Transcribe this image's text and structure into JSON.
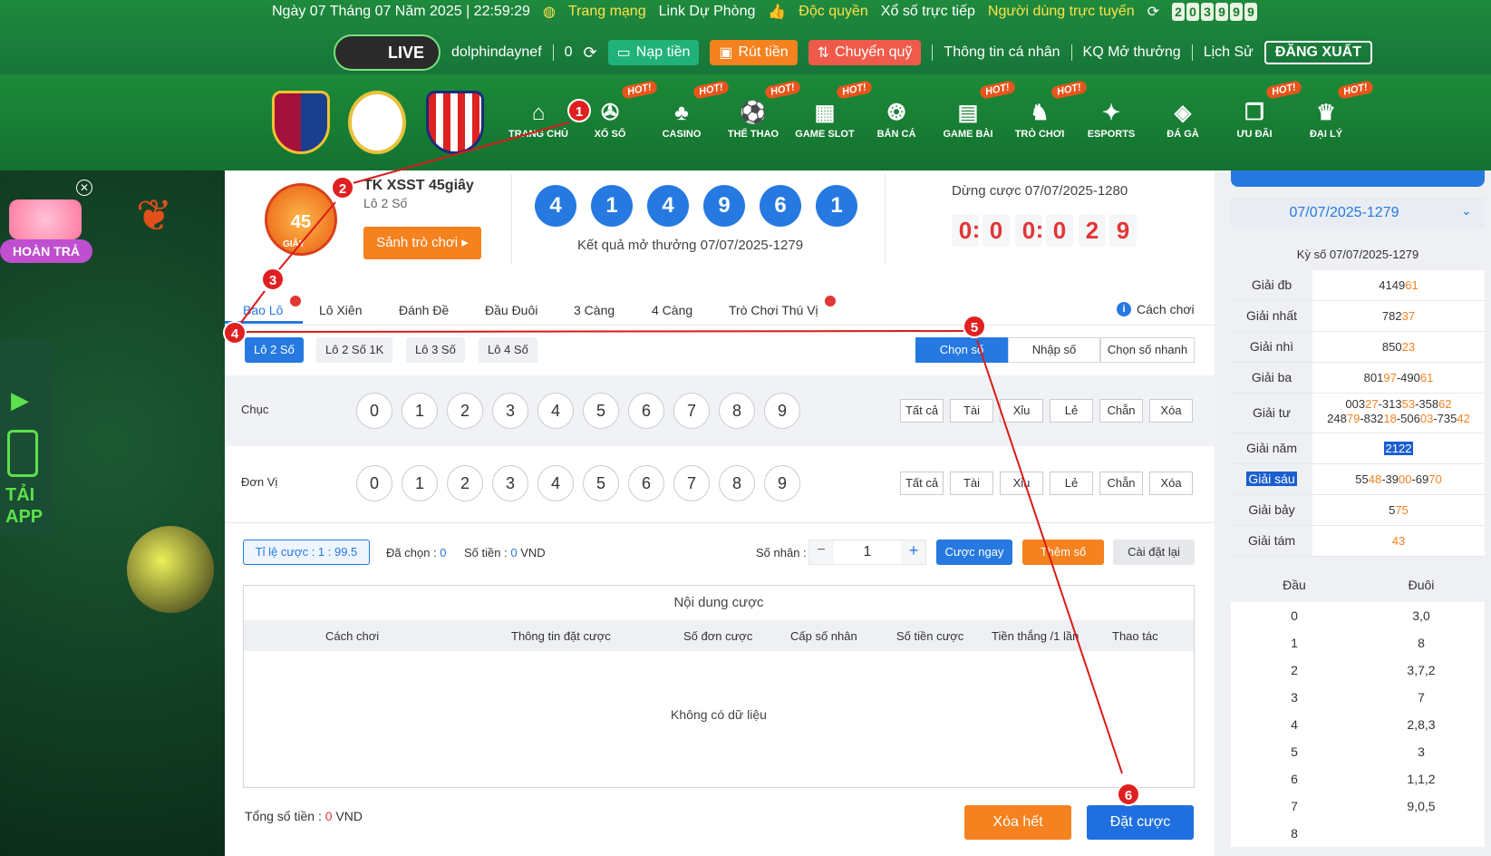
{
  "top": {
    "date": "Ngày 07 Tháng 07 Năm 2025 | 22:59:29",
    "site": "Trang mạng",
    "backup": "Link Dự Phòng",
    "exclusive": "Độc quyền",
    "lottery_live": "Xổ số trực tiếp",
    "online_users_label": "Người dùng trực tuyến",
    "online_users_digits": [
      "2",
      "0",
      "3",
      "9",
      "9",
      "9"
    ]
  },
  "userbar": {
    "live": "LIVE",
    "username": "dolphindaynef",
    "balance": "0",
    "deposit": "Nạp tiền",
    "withdraw": "Rút tiền",
    "transfer": "Chuyển quỹ",
    "profile": "Thông tin cá nhân",
    "results": "KQ Mở thưởng",
    "history": "Lịch Sử",
    "logout": "ĐĂNG XUẤT"
  },
  "nav": [
    {
      "label": "TRANG CHỦ",
      "hot": false
    },
    {
      "label": "XỔ SỐ",
      "hot": true
    },
    {
      "label": "CASINO",
      "hot": true
    },
    {
      "label": "THỂ THAO",
      "hot": true
    },
    {
      "label": "GAME SLOT",
      "hot": true
    },
    {
      "label": "BẮN CÁ",
      "hot": false
    },
    {
      "label": "GAME BÀI",
      "hot": true
    },
    {
      "label": "TRÒ CHƠI",
      "hot": true
    },
    {
      "label": "ESPORTS",
      "hot": false
    },
    {
      "label": "ĐÁ GÀ",
      "hot": false
    },
    {
      "label": "ƯU ĐÃI",
      "hot": true
    },
    {
      "label": "ĐẠI LÝ",
      "hot": true
    }
  ],
  "hot_label": "HOT!",
  "left": {
    "refund": "HOÀN TRẢ",
    "app1": "TẢI",
    "app2": "APP"
  },
  "game": {
    "logo": "45",
    "logo_sub": "GIÂY",
    "title": "TK XSST 45giây",
    "subtitle": "Lô 2 Số",
    "lobby": "Sảnh trò chơi ▸",
    "result_balls": [
      "4",
      "1",
      "4",
      "9",
      "6",
      "1"
    ],
    "result_caption": "Kết quả mở thưởng 07/07/2025-1279",
    "stop_caption": "Dừng cược 07/07/2025-1280",
    "timer": [
      "0",
      "0",
      "0",
      "0",
      "2",
      "9"
    ]
  },
  "tabs": [
    "Bao Lô",
    "Lô Xiên",
    "Đánh Đề",
    "Đầu Đuôi",
    "3 Càng",
    "4 Càng",
    "Trò Chơi Thú Vị"
  ],
  "how_to": "Cách chơi",
  "subtabs": [
    "Lô 2 Số",
    "Lô 2 Số 1K",
    "Lô 3 Số",
    "Lô 4 Số"
  ],
  "modes": [
    "Chọn số",
    "Nhập số",
    "Chọn số nhanh"
  ],
  "rows": [
    {
      "label": "Chục",
      "numbers": [
        "0",
        "1",
        "2",
        "3",
        "4",
        "5",
        "6",
        "7",
        "8",
        "9"
      ]
    },
    {
      "label": "Đơn Vị",
      "numbers": [
        "0",
        "1",
        "2",
        "3",
        "4",
        "5",
        "6",
        "7",
        "8",
        "9"
      ]
    }
  ],
  "filters": [
    "Tất cả",
    "Tài",
    "Xỉu",
    "Lẻ",
    "Chẵn",
    "Xóa"
  ],
  "bet": {
    "ratio": "Tỉ lệ cược : 1 : 99.5",
    "chosen_label": "Đã chọn :",
    "chosen": "0",
    "amount_label": "Số tiền :",
    "amount": "0",
    "currency": "VND",
    "multiplier_label": "Số nhân :",
    "multiplier": "1",
    "minus": "−",
    "plus": "+",
    "bet_now": "Cược ngay",
    "add": "Thêm số",
    "reset": "Cài đặt lại"
  },
  "table": {
    "title": "Nội dung cược",
    "headers": [
      "Cách chơi",
      "Thông tin đặt cược",
      "Số đơn cược",
      "Cấp số nhân",
      "Số tiền cược",
      "Tiền thắng /1 lần",
      "Thao tác"
    ],
    "empty": "Không có dữ liệu"
  },
  "footer": {
    "total_label": "Tổng số tiền :",
    "total": "0",
    "currency": "VND",
    "clear": "Xóa hết",
    "place": "Đặt cược"
  },
  "right": {
    "period": "07/07/2025-1279",
    "period_title": "Kỳ số 07/07/2025-1279",
    "prizes": [
      {
        "label": "Giải đb",
        "lines": [
          [
            [
              "4149",
              "n"
            ],
            [
              "61",
              "o"
            ]
          ]
        ]
      },
      {
        "label": "Giải nhất",
        "lines": [
          [
            [
              "782",
              "n"
            ],
            [
              "37",
              "o"
            ]
          ]
        ]
      },
      {
        "label": "Giải nhì",
        "lines": [
          [
            [
              "850",
              "n"
            ],
            [
              "23",
              "o"
            ]
          ]
        ]
      },
      {
        "label": "Giải ba",
        "lines": [
          [
            [
              "801",
              "n"
            ],
            [
              "97",
              "o"
            ],
            [
              "-490",
              "n"
            ],
            [
              "61",
              "o"
            ]
          ]
        ]
      },
      {
        "label": "Giải tư",
        "lines": [
          [
            [
              "003",
              "n"
            ],
            [
              "27",
              "o"
            ],
            [
              "-313",
              "n"
            ],
            [
              "53",
              "o"
            ],
            [
              "-358",
              "n"
            ],
            [
              "62",
              "o"
            ]
          ],
          [
            [
              "248",
              "n"
            ],
            [
              "79",
              "o"
            ],
            [
              "-832",
              "n"
            ],
            [
              "18",
              "o"
            ],
            [
              "-506",
              "n"
            ],
            [
              "03",
              "o"
            ],
            [
              "-735",
              "n"
            ],
            [
              "42",
              "o"
            ]
          ]
        ]
      },
      {
        "label": "Giải năm",
        "lines": [
          [
            [
              "2122",
              "h"
            ]
          ]
        ]
      },
      {
        "label": "Giải sáu",
        "lines": [
          [
            [
              "55",
              "n"
            ],
            [
              "48",
              "o"
            ],
            [
              "-39",
              "n"
            ],
            [
              "00",
              "o"
            ],
            [
              "-69",
              "n"
            ],
            [
              "70",
              "o"
            ]
          ]
        ]
      },
      {
        "label": "Giải bảy",
        "lines": [
          [
            [
              "5",
              "n"
            ],
            [
              "75",
              "o"
            ]
          ]
        ]
      },
      {
        "label": "Giải tám",
        "lines": [
          [
            [
              "43",
              "o"
            ]
          ]
        ]
      }
    ],
    "head_label": "Đầu",
    "tail_label": "Đuôi",
    "dd": [
      [
        "0",
        "3,0"
      ],
      [
        "1",
        "8"
      ],
      [
        "2",
        "3,7,2"
      ],
      [
        "3",
        "7"
      ],
      [
        "4",
        "2,8,3"
      ],
      [
        "5",
        "3"
      ],
      [
        "6",
        "1,1,2"
      ],
      [
        "7",
        "9,0,5"
      ],
      [
        "8",
        ""
      ]
    ]
  },
  "markers": [
    "1",
    "2",
    "3",
    "4",
    "5",
    "6"
  ],
  "colors": {
    "accent": "#2579e0",
    "orange": "#f5821f",
    "red": "#e23636",
    "green": "#1c8a38"
  }
}
